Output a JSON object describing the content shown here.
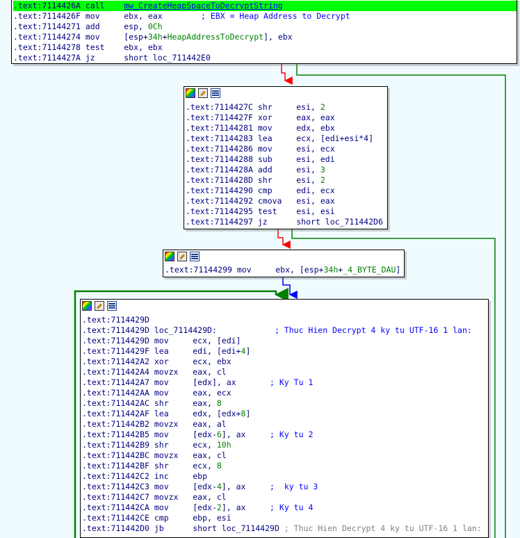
{
  "blocks": [
    {
      "lines": [
        {
          "seg": [
            ".text:7114426A",
            " call    ",
            "mw_CreateHeapSpaceToDecryptString"
          ],
          "hl": true
        },
        {
          "seg": [
            ".text:7114426F",
            " mov     ",
            "ebx, eax",
            "        ; EBX = Heap Address to Decrypt"
          ]
        },
        {
          "seg": [
            ".text:71144271",
            " add     ",
            "esp, ",
            "0Ch"
          ]
        },
        {
          "seg": [
            ".text:71144274",
            " mov     ",
            "[esp+",
            "34h",
            "+",
            "HeapAddressToDecrypt",
            "], ebx"
          ]
        },
        {
          "seg": [
            ".text:71144278",
            " test    ",
            "ebx, ebx"
          ]
        },
        {
          "seg": [
            ".text:7114427A",
            " jz      ",
            "short loc_711442E0"
          ]
        }
      ]
    },
    {
      "lines": [
        {
          "seg": [
            ".text:7114427C",
            " shr     ",
            "esi, ",
            "2"
          ]
        },
        {
          "seg": [
            ".text:7114427F",
            " xor     ",
            "eax, eax"
          ]
        },
        {
          "seg": [
            ".text:71144281",
            " mov     ",
            "edx, ebx"
          ]
        },
        {
          "seg": [
            ".text:71144283",
            " lea     ",
            "ecx, [edi+esi*4]"
          ]
        },
        {
          "seg": [
            ".text:71144286",
            " mov     ",
            "esi, ecx"
          ]
        },
        {
          "seg": [
            ".text:71144288",
            " sub     ",
            "esi, edi"
          ]
        },
        {
          "seg": [
            ".text:7114428A",
            " add     ",
            "esi, ",
            "3"
          ]
        },
        {
          "seg": [
            ".text:7114428D",
            " shr     ",
            "esi, ",
            "2"
          ]
        },
        {
          "seg": [
            ".text:71144290",
            " cmp     ",
            "edi, ecx"
          ]
        },
        {
          "seg": [
            ".text:71144292",
            " cmova   ",
            "esi, eax"
          ]
        },
        {
          "seg": [
            ".text:71144295",
            " test    ",
            "esi, esi"
          ]
        },
        {
          "seg": [
            ".text:71144297",
            " jz      ",
            "short loc_711442D6"
          ]
        }
      ]
    },
    {
      "lines": [
        {
          "seg": [
            ".text:71144299",
            " mov     ",
            "ebx, [esp+",
            "34h",
            "+",
            "_4_BYTE_DAU",
            "]"
          ]
        }
      ]
    },
    {
      "lines": [
        {
          "seg": [
            ".text:7114429D"
          ]
        },
        {
          "seg": [
            ".text:7114429D",
            " loc_7114429D:",
            "            ; Thuc Hien Decrypt 4 ky tu UTF-16 1 lan:"
          ]
        },
        {
          "seg": [
            ".text:7114429D",
            " mov     ",
            "ecx, [edi]"
          ]
        },
        {
          "seg": [
            ".text:7114429F",
            " lea     ",
            "edi, [edi+",
            "4",
            "]"
          ]
        },
        {
          "seg": [
            ".text:711442A2",
            " xor     ",
            "ecx, ebx"
          ]
        },
        {
          "seg": [
            ".text:711442A4",
            " movzx   ",
            "eax, cl"
          ]
        },
        {
          "seg": [
            ".text:711442A7",
            " mov     ",
            "[edx], ax",
            "       ; Ky Tu 1"
          ]
        },
        {
          "seg": [
            ".text:711442AA",
            " mov     ",
            "eax, ecx"
          ]
        },
        {
          "seg": [
            ".text:711442AC",
            " shr     ",
            "eax, ",
            "8"
          ]
        },
        {
          "seg": [
            ".text:711442AF",
            " lea     ",
            "edx, [edx+",
            "8",
            "]"
          ]
        },
        {
          "seg": [
            ".text:711442B2",
            " movzx   ",
            "eax, al"
          ]
        },
        {
          "seg": [
            ".text:711442B5",
            " mov     ",
            "[edx-",
            "6",
            "], ax",
            "     ; Ky tu 2"
          ]
        },
        {
          "seg": [
            ".text:711442B9",
            " shr     ",
            "ecx, ",
            "10h"
          ]
        },
        {
          "seg": [
            ".text:711442BC",
            " movzx   ",
            "eax, cl"
          ]
        },
        {
          "seg": [
            ".text:711442BF",
            " shr     ",
            "ecx, ",
            "8"
          ]
        },
        {
          "seg": [
            ".text:711442C2",
            " inc     ",
            "ebp"
          ]
        },
        {
          "seg": [
            ".text:711442C3",
            " mov     ",
            "[edx-",
            "4",
            "], ax",
            "     ;  ky tu 3"
          ]
        },
        {
          "seg": [
            ".text:711442C7",
            " movzx   ",
            "eax, cl"
          ]
        },
        {
          "seg": [
            ".text:711442CA",
            " mov     ",
            "[edx-",
            "2",
            "], ax",
            "     ; Ky tu 4"
          ]
        },
        {
          "seg": [
            ".text:711442CE",
            " cmp     ",
            "ebp, esi"
          ]
        },
        {
          "seg": [
            ".text:711442D0",
            " jb      ",
            "short loc_7114429D",
            " ; Thuc Hien Decrypt 4 ky tu UTF-16 1 lan:"
          ]
        }
      ]
    }
  ],
  "colors": {
    "background": "#f0fbff",
    "highlight": "#00ff00",
    "edge_true": "#008000",
    "edge_false": "#ff0000",
    "edge_uncond": "#0000ff"
  },
  "icons": [
    "graph-colors-icon",
    "edit-node-icon",
    "list-view-icon"
  ]
}
